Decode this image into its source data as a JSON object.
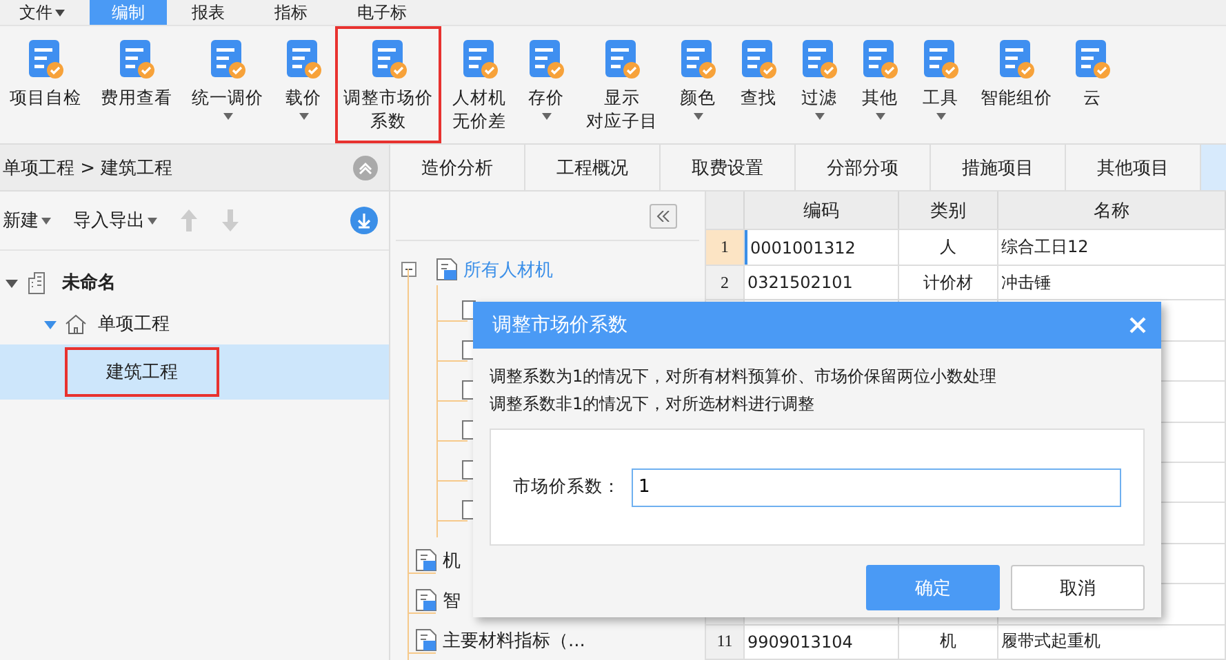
{
  "menu": [
    {
      "label": "文件",
      "dropdown": true,
      "selected": false
    },
    {
      "label": "编制",
      "dropdown": false,
      "selected": true
    },
    {
      "label": "报表",
      "dropdown": false,
      "selected": false
    },
    {
      "label": "指标",
      "dropdown": false,
      "selected": false
    },
    {
      "label": "电子标",
      "dropdown": false,
      "selected": false
    }
  ],
  "toolbar": [
    {
      "lines": [
        "项目自检"
      ],
      "dropdown": false,
      "highlighted": false
    },
    {
      "lines": [
        "费用查看"
      ],
      "dropdown": false,
      "highlighted": false
    },
    {
      "lines": [
        "统一调价"
      ],
      "dropdown": true,
      "highlighted": false
    },
    {
      "lines": [
        "载价"
      ],
      "dropdown": true,
      "highlighted": false
    },
    {
      "lines": [
        "调整市场价",
        "系数"
      ],
      "dropdown": false,
      "highlighted": true
    },
    {
      "lines": [
        "人材机",
        "无价差"
      ],
      "dropdown": false,
      "highlighted": false
    },
    {
      "lines": [
        "存价"
      ],
      "dropdown": true,
      "highlighted": false
    },
    {
      "lines": [
        "显示",
        "对应子目"
      ],
      "dropdown": false,
      "highlighted": false
    },
    {
      "lines": [
        "颜色"
      ],
      "dropdown": true,
      "highlighted": false
    },
    {
      "lines": [
        "查找"
      ],
      "dropdown": false,
      "highlighted": false
    },
    {
      "lines": [
        "过滤"
      ],
      "dropdown": true,
      "highlighted": false
    },
    {
      "lines": [
        "其他"
      ],
      "dropdown": true,
      "highlighted": false
    },
    {
      "lines": [
        "工具"
      ],
      "dropdown": true,
      "highlighted": false
    },
    {
      "lines": [
        "智能组价"
      ],
      "dropdown": false,
      "highlighted": false
    },
    {
      "lines": [
        "云"
      ],
      "dropdown": false,
      "highlighted": false
    }
  ],
  "left_panel": {
    "breadcrumb": "单项工程 > 建筑工程",
    "actions": [
      {
        "label": "新建",
        "dropdown": true
      },
      {
        "label": "导入导出",
        "dropdown": true
      }
    ],
    "tree": [
      {
        "label": "未命名",
        "expanded": true,
        "selected": false,
        "highlighted": false,
        "children": [
          {
            "label": "单项工程",
            "expanded": true,
            "selected": false,
            "highlighted": false,
            "children": [
              {
                "label": "建筑工程",
                "selected": true,
                "highlighted": true
              }
            ]
          }
        ]
      }
    ]
  },
  "tabs": [
    {
      "label": "造价分析",
      "selected": false
    },
    {
      "label": "工程概况",
      "selected": false
    },
    {
      "label": "取费设置",
      "selected": false
    },
    {
      "label": "分部分项",
      "selected": false
    },
    {
      "label": "措施项目",
      "selected": false
    },
    {
      "label": "其他项目",
      "selected": false
    }
  ],
  "category_tree": {
    "root": {
      "label": "所有人材机",
      "expanded": true,
      "selected": true
    },
    "covered_children": [
      {
        "kind": "document"
      },
      {
        "kind": "document"
      },
      {
        "kind": "document"
      },
      {
        "kind": "document"
      },
      {
        "kind": "document"
      },
      {
        "kind": "document"
      }
    ],
    "siblings": [
      {
        "label": "机"
      },
      {
        "label": "智"
      },
      {
        "label": "主要材料指标（..."
      }
    ]
  },
  "grid": {
    "columns": [
      "编码",
      "类别",
      "名称"
    ],
    "rows": [
      {
        "kind": "data",
        "index": "1",
        "code": "0001001312",
        "type": "人",
        "name": "综合工日12",
        "current": true
      },
      {
        "kind": "data",
        "index": "2",
        "code": "0321502101",
        "type": "计价材",
        "name": "冲击锤",
        "current": false
      },
      {
        "kind": "covered"
      },
      {
        "kind": "covered"
      },
      {
        "kind": "covered"
      },
      {
        "kind": "covered"
      },
      {
        "kind": "covered"
      },
      {
        "kind": "covered"
      },
      {
        "kind": "covered"
      },
      {
        "kind": "covered"
      },
      {
        "kind": "data",
        "index": "11",
        "code": "9909013104",
        "type": "机",
        "name": "履带式起重机",
        "current": false
      }
    ]
  },
  "dialog": {
    "title": "调整市场价系数",
    "message": [
      "调整系数为1的情况下，对所有材料预算价、市场价保留两位小数处理",
      "调整系数非1的情况下，对所选材料进行调整"
    ],
    "field": {
      "label": "市场价系数：",
      "value": "1"
    },
    "buttons": [
      {
        "label": "确定",
        "kind": "primary"
      },
      {
        "label": "取消",
        "kind": "default"
      }
    ]
  }
}
